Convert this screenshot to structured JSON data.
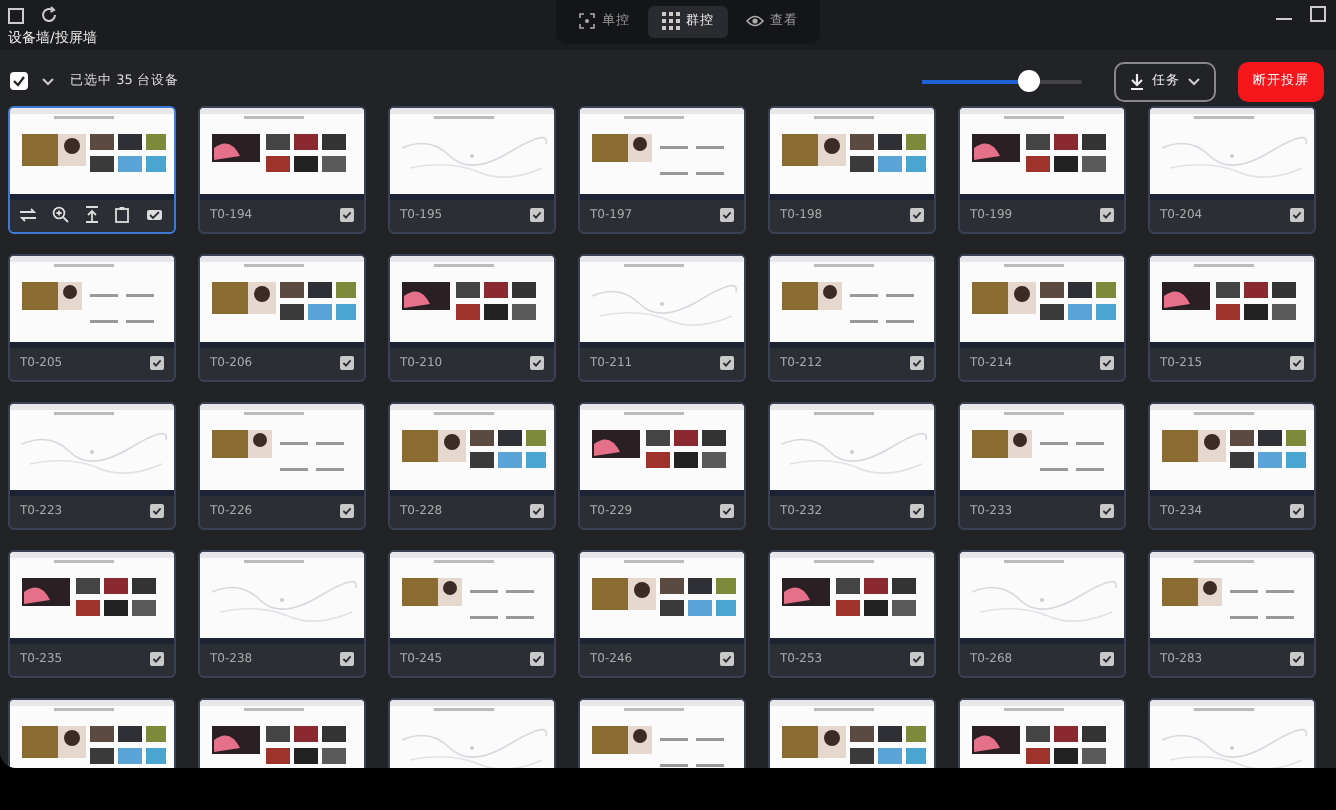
{
  "window": {
    "title": "设备墙/投屏墙"
  },
  "modes": [
    {
      "label": "单控",
      "selected": false
    },
    {
      "label": "群控",
      "selected": true
    },
    {
      "label": "查看",
      "selected": false
    }
  ],
  "selection": {
    "checked": true,
    "text": "已选中 35 台设备"
  },
  "zoom_slider": {
    "level": 0.66
  },
  "task_button": {
    "label": "任务"
  },
  "disconnect_button": {
    "label": "断开投屏"
  },
  "devices": [
    {
      "kind": "hover",
      "selected": true
    },
    {
      "kind": "card",
      "label": "T0-194",
      "checked": true,
      "selected": false
    },
    {
      "kind": "card",
      "label": "T0-195",
      "checked": true,
      "selected": false
    },
    {
      "kind": "card",
      "label": "T0-197",
      "checked": true,
      "selected": false
    },
    {
      "kind": "card",
      "label": "T0-198",
      "checked": true,
      "selected": false
    },
    {
      "kind": "card",
      "label": "T0-199",
      "checked": true,
      "selected": false
    },
    {
      "kind": "card",
      "label": "T0-204",
      "checked": true,
      "selected": false
    },
    {
      "kind": "card",
      "label": "T0-205",
      "checked": true,
      "selected": false
    },
    {
      "kind": "card",
      "label": "T0-206",
      "checked": true,
      "selected": false
    },
    {
      "kind": "card",
      "label": "T0-210",
      "checked": true,
      "selected": false
    },
    {
      "kind": "card",
      "label": "T0-211",
      "checked": true,
      "selected": false
    },
    {
      "kind": "card",
      "label": "T0-212",
      "checked": true,
      "selected": false
    },
    {
      "kind": "card",
      "label": "T0-214",
      "checked": true,
      "selected": false
    },
    {
      "kind": "card",
      "label": "T0-215",
      "checked": true,
      "selected": false
    },
    {
      "kind": "card",
      "label": "T0-223",
      "checked": true,
      "selected": false
    },
    {
      "kind": "card",
      "label": "T0-226",
      "checked": true,
      "selected": false
    },
    {
      "kind": "card",
      "label": "T0-228",
      "checked": true,
      "selected": false
    },
    {
      "kind": "card",
      "label": "T0-229",
      "checked": true,
      "selected": false
    },
    {
      "kind": "card",
      "label": "T0-232",
      "checked": true,
      "selected": false
    },
    {
      "kind": "card",
      "label": "T0-233",
      "checked": true,
      "selected": false
    },
    {
      "kind": "card",
      "label": "T0-234",
      "checked": true,
      "selected": false
    },
    {
      "kind": "card",
      "label": "T0-235",
      "checked": true,
      "selected": false
    },
    {
      "kind": "card",
      "label": "T0-238",
      "checked": true,
      "selected": false
    },
    {
      "kind": "card",
      "label": "T0-245",
      "checked": true,
      "selected": false
    },
    {
      "kind": "card",
      "label": "T0-246",
      "checked": true,
      "selected": false
    },
    {
      "kind": "card",
      "label": "T0-253",
      "checked": true,
      "selected": false
    },
    {
      "kind": "card",
      "label": "T0-268",
      "checked": true,
      "selected": false
    },
    {
      "kind": "card",
      "label": "T0-283",
      "checked": true,
      "selected": false
    },
    {
      "kind": "cut"
    },
    {
      "kind": "cut"
    },
    {
      "kind": "cut"
    },
    {
      "kind": "cut"
    },
    {
      "kind": "cut"
    },
    {
      "kind": "cut"
    },
    {
      "kind": "cut"
    }
  ]
}
